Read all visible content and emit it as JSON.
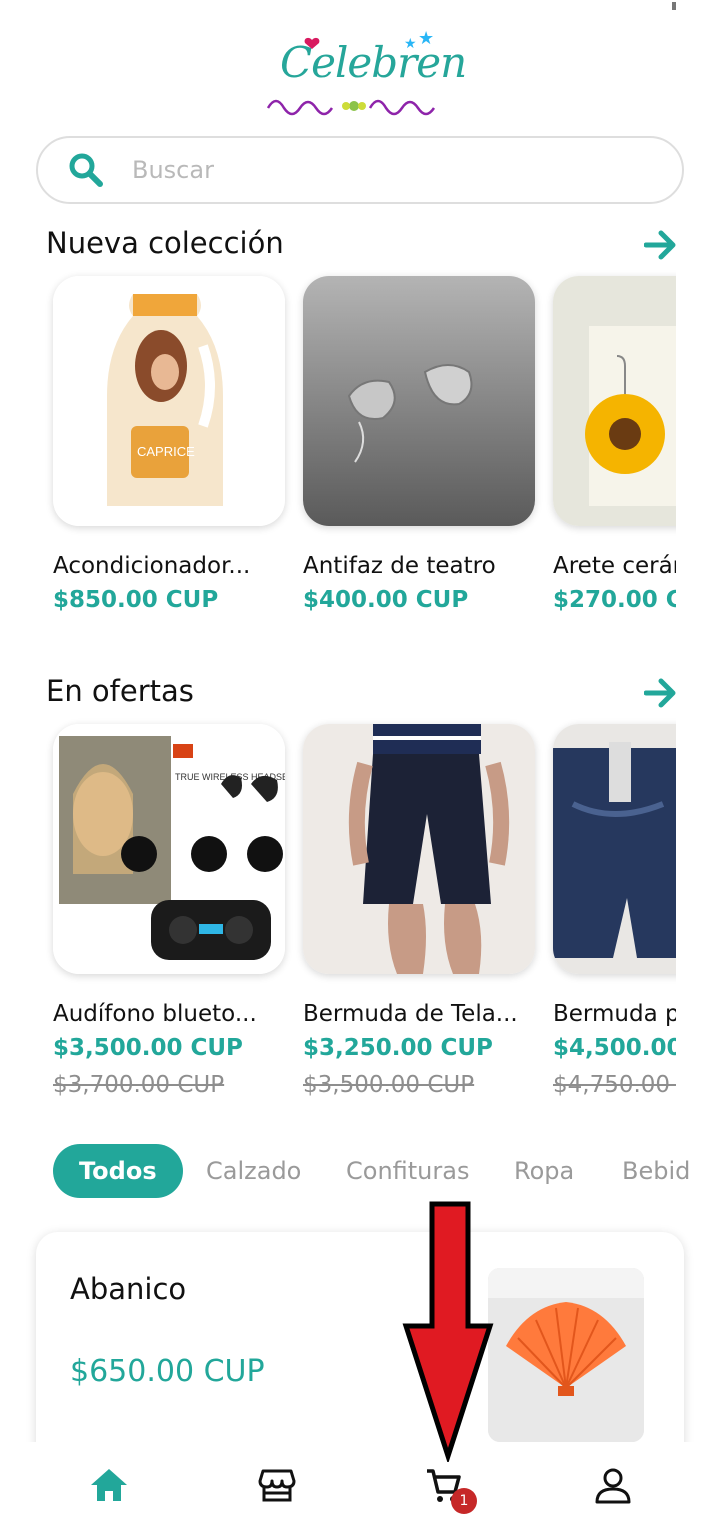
{
  "header": {
    "logo_text": "Celebren"
  },
  "search": {
    "placeholder": "Buscar"
  },
  "new_collection": {
    "title": "Nueva colección",
    "items": [
      {
        "name": "Acondicionador...",
        "price": "$850.00 CUP"
      },
      {
        "name": "Antifaz de teatro",
        "price": "$400.00 CUP"
      },
      {
        "name": "Arete cerár",
        "price": "$270.00 CU"
      }
    ]
  },
  "offers": {
    "title": "En ofertas",
    "items": [
      {
        "name": "Audífono blueto...",
        "price": "$3,500.00 CUP",
        "old_price": "$3,700.00 CUP",
        "img_text": "TRUE WIRELESS HEADSET"
      },
      {
        "name": "Bermuda de Tela...",
        "price": "$3,250.00 CUP",
        "old_price": "$3,500.00 CUP"
      },
      {
        "name": "Bermuda p",
        "price": "$4,500.00 C",
        "old_price": "$4,750.00 C"
      }
    ]
  },
  "categories": [
    "Todos",
    "Calzado",
    "Confituras",
    "Ropa",
    "Bebid"
  ],
  "product": {
    "name": "Abanico",
    "price": "$650.00 CUP"
  },
  "nav": {
    "cart_badge": "1"
  },
  "colors": {
    "accent": "#22a79a",
    "badge": "#c62828",
    "arrow": "#e01a22"
  }
}
